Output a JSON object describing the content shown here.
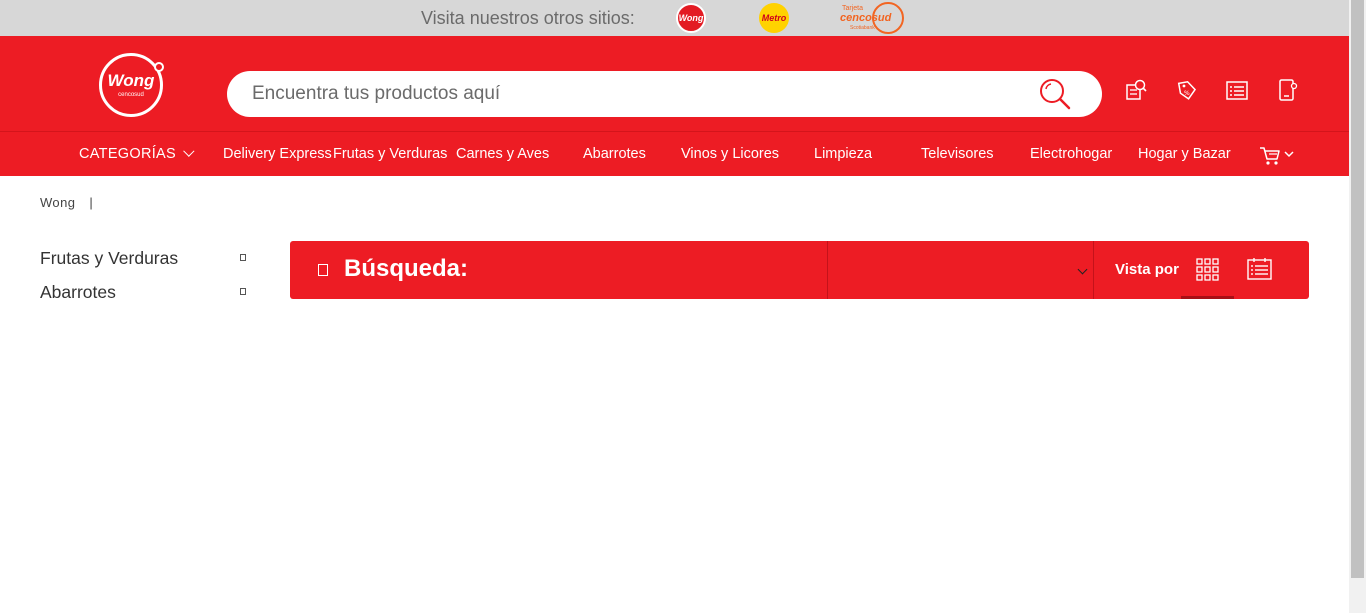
{
  "topbar": {
    "visit_text": "Visita nuestros otros sitios:",
    "sites": [
      {
        "name": "Wong",
        "icon": "wong-logo"
      },
      {
        "name": "Metro",
        "icon": "metro-logo"
      },
      {
        "name": "Tarjeta Cencosud",
        "icon": "tarjeta-cencosud-logo",
        "line1": "Tarjeta",
        "line2": "cencosud",
        "line3": "Scotiabank"
      }
    ]
  },
  "header": {
    "logo_text": "Wong",
    "logo_sub": "cencosud",
    "search": {
      "placeholder": "Encuentra tus productos aquí",
      "icon": "search-icon"
    },
    "icons": [
      "order-search-icon",
      "offers-tag-icon",
      "list-icon",
      "mobile-icon"
    ]
  },
  "nav": {
    "categories_label": "CATEGORÍAS",
    "items": [
      "Delivery Express",
      "Frutas y Verduras",
      "Carnes y Aves",
      "Abarrotes",
      "Vinos y Licores",
      "Limpieza",
      "Televisores",
      "Electrohogar",
      "Hogar y Bazar"
    ],
    "cart_icon": "cart-icon"
  },
  "breadcrumb": {
    "home": "Wong",
    "separator": "|"
  },
  "sidebar": {
    "items": [
      {
        "label": "Frutas y Verduras"
      },
      {
        "label": "Abarrotes"
      }
    ]
  },
  "results": {
    "title": "Búsqueda:",
    "sort_value": "",
    "view_label": "Vista por",
    "view_modes": [
      "grid-view-icon",
      "list-view-icon"
    ],
    "active_view": "grid"
  },
  "colors": {
    "brand_red": "#ed1c24",
    "topbar_gray": "#d7d7d7",
    "metro_yellow": "#ffd200",
    "cencosud_orange": "#f26522"
  }
}
